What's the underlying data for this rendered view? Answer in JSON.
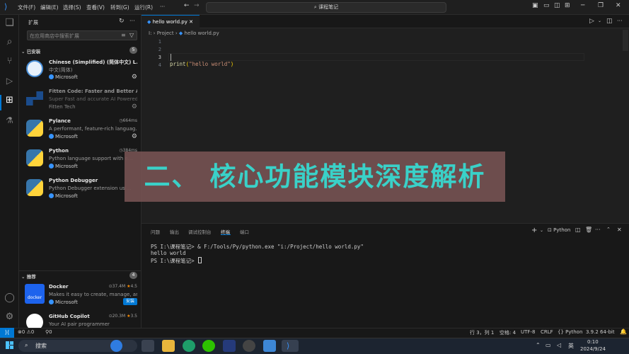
{
  "titlebar": {
    "menus": [
      "文件(F)",
      "编辑(E)",
      "选择(S)",
      "查看(V)",
      "转到(G)",
      "运行(R)",
      "···"
    ],
    "search": "课程笔记"
  },
  "sidebar": {
    "header": "扩展",
    "search_placeholder": "在应用商店中搜索扩展",
    "installed_label": "已安装",
    "installed_count": "5",
    "installed": [
      {
        "name": "Chinese (Simplified) (简体中文) L...",
        "desc": "中文(简体)",
        "publisher": "Microsoft",
        "stat": ""
      },
      {
        "name": "Fitten Code: Faster and Better AI ...",
        "desc": "Super Fast and accurate AI Powered...",
        "publisher": "Fitten Tech",
        "stat": ""
      },
      {
        "name": "Pylance",
        "desc": "A performant, feature-rich languag...",
        "publisher": "Microsoft",
        "stat": "664ms"
      },
      {
        "name": "Python",
        "desc": "Python language support with e...",
        "publisher": "Microsoft",
        "stat": "384ms"
      },
      {
        "name": "Python Debugger",
        "desc": "Python Debugger extension usi...",
        "publisher": "Microsoft",
        "stat": ""
      }
    ],
    "recommended_label": "推荐",
    "recommended_count": "4",
    "recommended": [
      {
        "name": "Docker",
        "desc": "Makes it easy to create, manage, an...",
        "publisher": "Microsoft",
        "downloads": "37.4M",
        "rating": "4.5",
        "button": "安装"
      },
      {
        "name": "GitHub Copilot",
        "desc": "Your AI pair programmer",
        "publisher": "",
        "downloads": "20.3M",
        "rating": "3.5",
        "button": ""
      }
    ]
  },
  "editor": {
    "tab": "hello world.py",
    "breadcrumb": [
      "I:",
      "Project",
      "hello world.py"
    ],
    "line_numbers": [
      "1",
      "2",
      "3",
      "4"
    ],
    "code_fn": "print",
    "code_str": "\"hello world\"",
    "code_open": "(",
    "code_close": ")"
  },
  "overlay": {
    "text": "二、 核心功能模块深度解析"
  },
  "panel": {
    "tabs": [
      "问题",
      "输出",
      "调试控制台",
      "终端",
      "端口"
    ],
    "active_tab": "终端",
    "shell": "Python",
    "lines": [
      "PS I:\\课程笔记> & F:/Tools/Py/python.exe \"i:/Project/hello world.py\"",
      "hello world",
      "PS I:\\课程笔记> "
    ]
  },
  "status": {
    "errors": "⊗0 ⚠0",
    "ports": "⚲0",
    "position": "行 3，列 1",
    "spaces": "空格: 4",
    "encoding": "UTF-8",
    "eol": "CRLF",
    "language": "{} Python",
    "interpreter": "3.9.2 64-bit"
  },
  "taskbar": {
    "search": "搜索",
    "ime": "英",
    "time": "0:10",
    "date": "2024/9/24"
  },
  "colors": {
    "accent": "#0078d4",
    "banner_bg": "#735151",
    "banner_text": "#3ad1c8"
  }
}
